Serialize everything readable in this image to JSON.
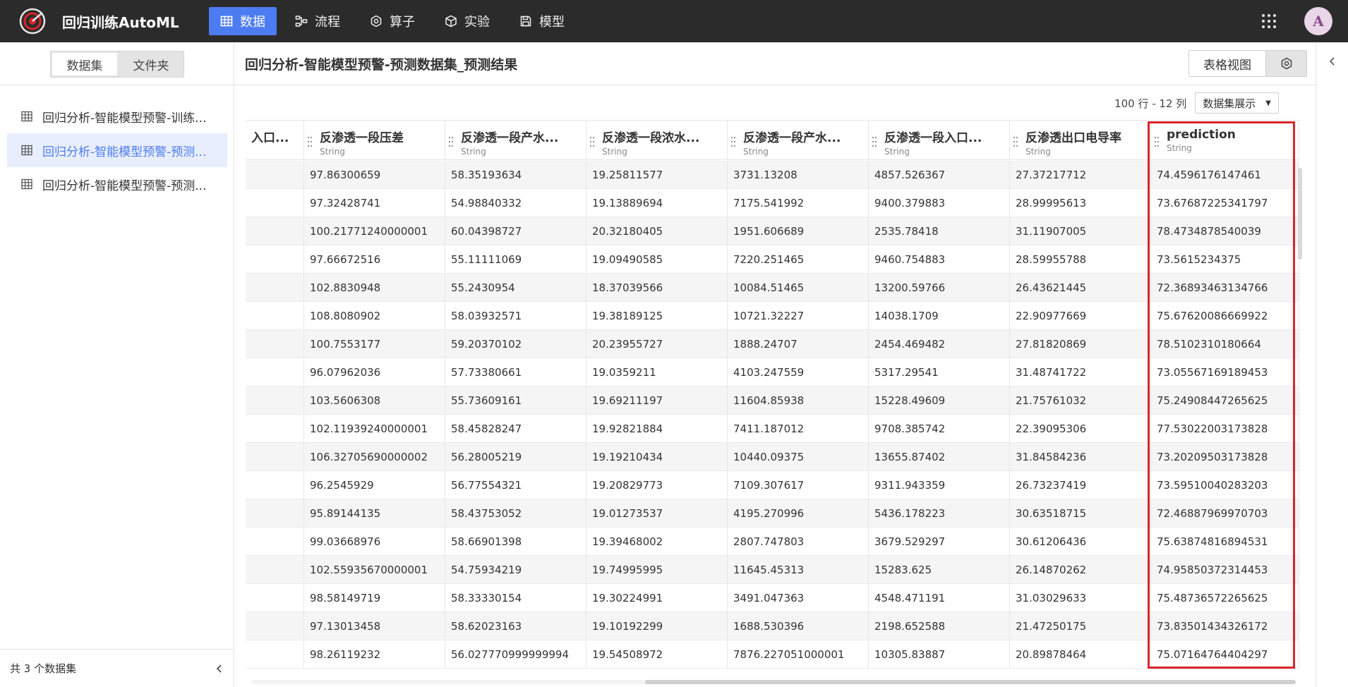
{
  "app": {
    "title": "回归训练AutoML",
    "avatar_letter": "A",
    "accent": "#4d7cf2"
  },
  "nav": [
    {
      "label": "数据",
      "icon": "table-icon",
      "active": true
    },
    {
      "label": "流程",
      "icon": "flow-icon",
      "active": false
    },
    {
      "label": "算子",
      "icon": "operator-icon",
      "active": false
    },
    {
      "label": "实验",
      "icon": "cube-icon",
      "active": false
    },
    {
      "label": "模型",
      "icon": "save-icon",
      "active": false
    }
  ],
  "sidebar": {
    "segments": [
      "数据集",
      "文件夹"
    ],
    "items": [
      {
        "label": "回归分析-智能模型预警-训练...",
        "active": false
      },
      {
        "label": "回归分析-智能模型预警-预测...",
        "active": true
      },
      {
        "label": "回归分析-智能模型预警-预测...",
        "active": false
      }
    ],
    "footer": "共 3 个数据集"
  },
  "main": {
    "title": "回归分析-智能模型预警-预测数据集_预测结果",
    "view_label": "表格视图",
    "row_info": "100 行 - 12 列",
    "display_mode": "数据集展示"
  },
  "table": {
    "columns": [
      {
        "name": "入口...",
        "type": ""
      },
      {
        "name": "反渗透一段压差",
        "type": "String"
      },
      {
        "name": "反渗透一段产水...",
        "type": "String"
      },
      {
        "name": "反渗透一段浓水...",
        "type": "String"
      },
      {
        "name": "反渗透一段产水...",
        "type": "String"
      },
      {
        "name": "反渗透一段入口...",
        "type": "String"
      },
      {
        "name": "反渗透出口电导率",
        "type": "String"
      },
      {
        "name": "prediction",
        "type": "String"
      }
    ],
    "rows": [
      [
        "",
        "97.86300659",
        "58.35193634",
        "19.25811577",
        "3731.13208",
        "4857.526367",
        "27.37217712",
        "74.4596176147461"
      ],
      [
        "",
        "97.32428741",
        "54.98840332",
        "19.13889694",
        "7175.541992",
        "9400.379883",
        "28.99995613",
        "73.67687225341797"
      ],
      [
        "",
        "100.21771240000001",
        "60.04398727",
        "20.32180405",
        "1951.606689",
        "2535.78418",
        "31.11907005",
        "78.4734878540039"
      ],
      [
        "",
        "97.66672516",
        "55.11111069",
        "19.09490585",
        "7220.251465",
        "9460.754883",
        "28.59955788",
        "73.5615234375"
      ],
      [
        "",
        "102.8830948",
        "55.2430954",
        "18.37039566",
        "10084.51465",
        "13200.59766",
        "26.43621445",
        "72.36893463134766"
      ],
      [
        "",
        "108.8080902",
        "58.03932571",
        "19.38189125",
        "10721.32227",
        "14038.1709",
        "22.90977669",
        "75.67620086669922"
      ],
      [
        "",
        "100.7553177",
        "59.20370102",
        "20.23955727",
        "1888.24707",
        "2454.469482",
        "27.81820869",
        "78.5102310180664"
      ],
      [
        "",
        "96.07962036",
        "57.73380661",
        "19.0359211",
        "4103.247559",
        "5317.29541",
        "31.48741722",
        "73.05567169189453"
      ],
      [
        "",
        "103.5606308",
        "55.73609161",
        "19.69211197",
        "11604.85938",
        "15228.49609",
        "21.75761032",
        "75.24908447265625"
      ],
      [
        "",
        "102.11939240000001",
        "58.45828247",
        "19.92821884",
        "7411.187012",
        "9708.385742",
        "22.39095306",
        "77.53022003173828"
      ],
      [
        "",
        "106.32705690000002",
        "56.28005219",
        "19.19210434",
        "10440.09375",
        "13655.87402",
        "31.84584236",
        "73.20209503173828"
      ],
      [
        "",
        "96.2545929",
        "56.77554321",
        "19.20829773",
        "7109.307617",
        "9311.943359",
        "26.73237419",
        "73.59510040283203"
      ],
      [
        "",
        "95.89144135",
        "58.43753052",
        "19.01273537",
        "4195.270996",
        "5436.178223",
        "30.63518715",
        "72.46887969970703"
      ],
      [
        "",
        "99.03668976",
        "58.66901398",
        "19.39468002",
        "2807.747803",
        "3679.529297",
        "30.61206436",
        "75.63874816894531"
      ],
      [
        "",
        "102.55935670000001",
        "54.75934219",
        "19.74995995",
        "11645.45313",
        "15283.625",
        "26.14870262",
        "74.95850372314453"
      ],
      [
        "",
        "98.58149719",
        "58.33330154",
        "19.30224991",
        "3491.047363",
        "4548.471191",
        "31.03029633",
        "75.48736572265625"
      ],
      [
        "",
        "97.13013458",
        "58.62023163",
        "19.10192299",
        "1688.530396",
        "2198.652588",
        "21.47250175",
        "73.83501434326172"
      ],
      [
        "",
        "98.26119232",
        "56.027770999999994",
        "19.54508972",
        "7876.227051000001",
        "10305.83887",
        "20.89878464",
        "75.07164764404297"
      ]
    ]
  }
}
